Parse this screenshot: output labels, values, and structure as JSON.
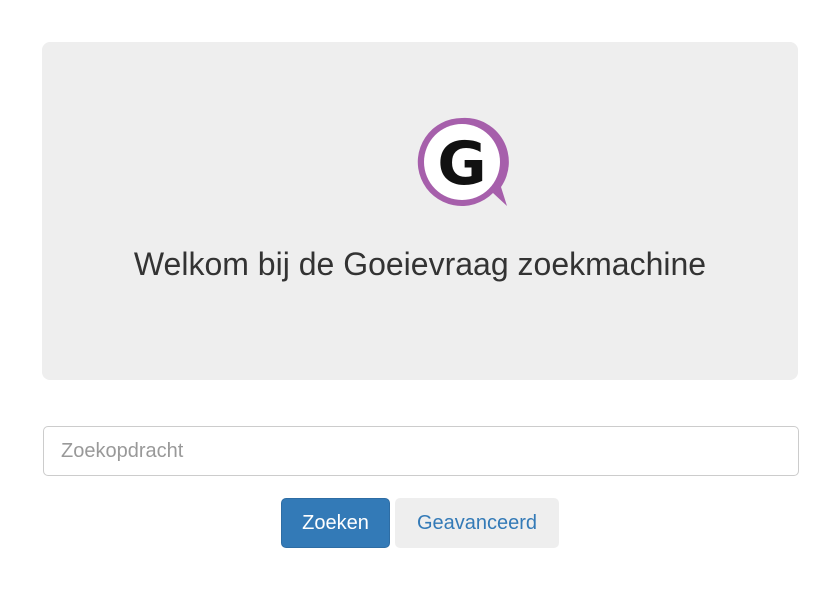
{
  "hero": {
    "logo_letter": "G",
    "logo_color": "#a65fab",
    "welcome_text": "Welkom bij de Goeievraag zoekmachine"
  },
  "search": {
    "value": "",
    "placeholder": "Zoekopdracht"
  },
  "buttons": {
    "search_label": "Zoeken",
    "advanced_label": "Geavanceerd"
  },
  "colors": {
    "primary": "#337ab7",
    "jumbotron_bg": "#eeeeee"
  }
}
